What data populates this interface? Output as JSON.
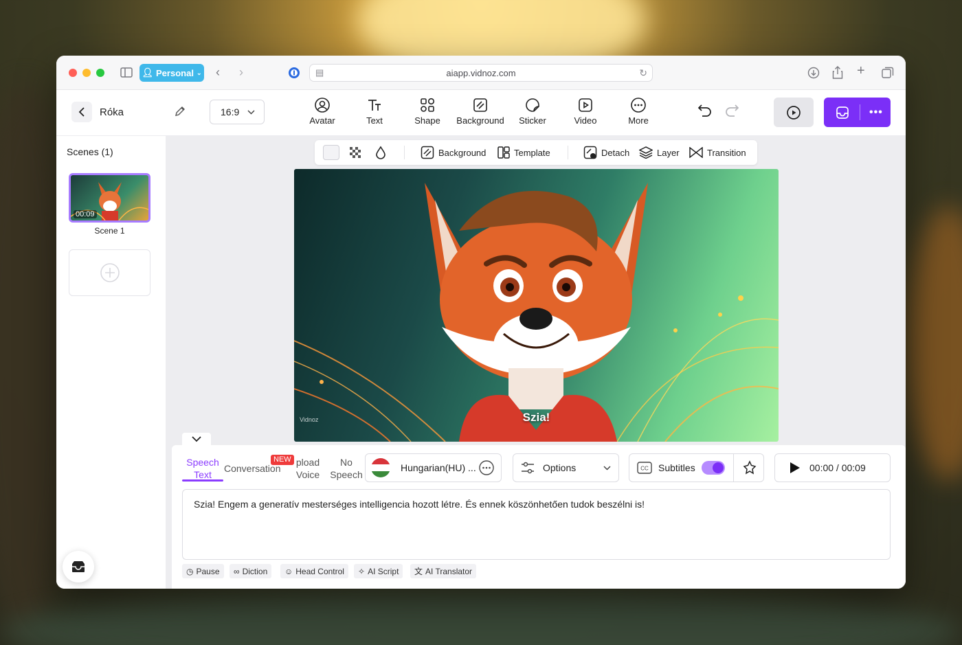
{
  "browser": {
    "profile_label": "Personal",
    "url": "aiapp.vidnoz.com"
  },
  "app": {
    "project_name": "Róka",
    "aspect_ratio": "16:9",
    "tools": [
      {
        "label": "Avatar",
        "icon": "avatar-icon"
      },
      {
        "label": "Text",
        "icon": "text-icon"
      },
      {
        "label": "Shape",
        "icon": "shape-icon"
      },
      {
        "label": "Background",
        "icon": "background-icon"
      },
      {
        "label": "Sticker",
        "icon": "sticker-icon"
      },
      {
        "label": "Video",
        "icon": "video-icon"
      },
      {
        "label": "More",
        "icon": "more-icon"
      }
    ],
    "accent_color": "#7b2ff7"
  },
  "scenes": {
    "title": "Scenes (1)",
    "items": [
      {
        "label": "Scene 1",
        "duration": "00:09"
      }
    ]
  },
  "canvas_toolbar": {
    "background_label": "Background",
    "template_label": "Template",
    "detach_label": "Detach",
    "layer_label": "Layer",
    "transition_label": "Transition"
  },
  "video": {
    "subtitle": "Szia!",
    "watermark": "Vidnoz"
  },
  "script_panel": {
    "tabs": [
      {
        "line1": "Speech",
        "line2": "Text"
      },
      {
        "line1": "Conversation",
        "line2": ""
      },
      {
        "line1": "pload",
        "line2": "Voice"
      },
      {
        "line1": "No",
        "line2": "Speech"
      }
    ],
    "new_badge": "NEW",
    "language": "Hungarian(HU) ...",
    "options_label": "Options",
    "subtitles_label": "Subtitles",
    "subtitles_on": true,
    "time": "00:00 / 00:09",
    "script_text": "Szia! Engem a generatív mesterséges intelligencia hozott létre. És ennek köszönhetően tudok beszélni is!",
    "chips": [
      "Pause",
      "Diction",
      "Head Control",
      "AI Script",
      "AI Translator"
    ]
  }
}
